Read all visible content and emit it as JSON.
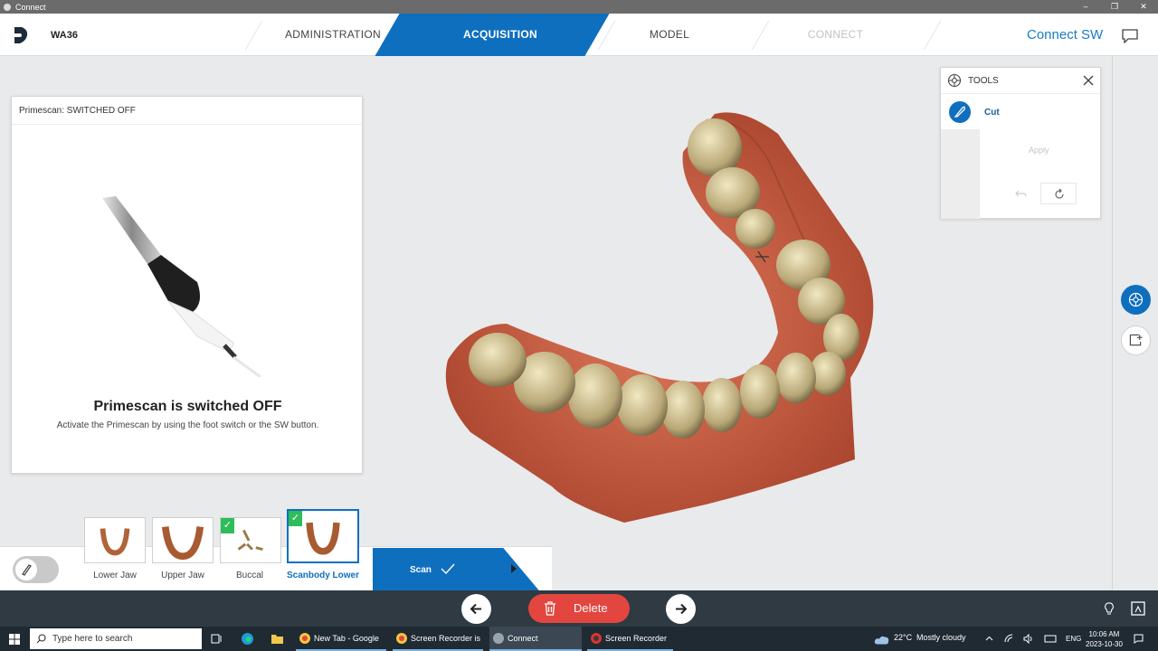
{
  "window": {
    "title": "Connect",
    "controls": [
      "–",
      "❐",
      "✕"
    ]
  },
  "header": {
    "workstation": "WA36",
    "steps": [
      {
        "label": "ADMINISTRATION",
        "state": "normal"
      },
      {
        "label": "ACQUISITION",
        "state": "active"
      },
      {
        "label": "MODEL",
        "state": "normal"
      },
      {
        "label": "CONNECT",
        "state": "disabled"
      }
    ],
    "connect_sw": "Connect SW",
    "accent": "#0f6fbf"
  },
  "status_panel": {
    "header": "Primescan: SWITCHED OFF",
    "title": "Primescan is switched OFF",
    "subtitle": "Activate the Primescan by using the foot switch or the SW button."
  },
  "tools": {
    "title": "TOOLS",
    "tool_name": "Cut",
    "apply": "Apply"
  },
  "catalog": [
    {
      "label": "Lower Jaw",
      "checked": false,
      "selected": false
    },
    {
      "label": "Upper Jaw",
      "checked": false,
      "selected": false
    },
    {
      "label": "Buccal",
      "checked": true,
      "selected": false
    },
    {
      "label": "Scanbody Lower",
      "checked": true,
      "selected": true
    }
  ],
  "scan_button": "Scan",
  "actions": {
    "delete": "Delete",
    "delete_color": "#e2463f"
  },
  "taskbar": {
    "search_placeholder": "Type here to search",
    "apps": [
      {
        "label": "New Tab - Google ...",
        "active": false
      },
      {
        "label": "Screen Recorder is ...",
        "active": false
      },
      {
        "label": "Connect",
        "active": true
      },
      {
        "label": "Screen Recorder",
        "active": false
      }
    ],
    "weather_temp": "22°C",
    "weather_text": "Mostly cloudy",
    "language": "ENG",
    "time": "10:06 AM",
    "date": "2023-10-30"
  }
}
